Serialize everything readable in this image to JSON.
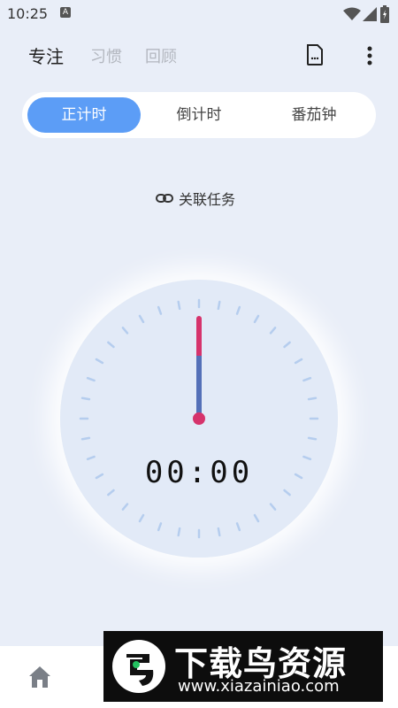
{
  "status_bar": {
    "time": "10:25",
    "notification_glyph": "A"
  },
  "header": {
    "tabs": [
      {
        "label": "专注",
        "active": true
      },
      {
        "label": "习惯",
        "active": false
      },
      {
        "label": "回顾",
        "active": false
      }
    ],
    "doc_icon": "document-icon",
    "more_icon": "more-vertical-icon"
  },
  "mode_selector": {
    "items": [
      {
        "label": "正计时",
        "selected": true
      },
      {
        "label": "倒计时",
        "selected": false
      },
      {
        "label": "番茄钟",
        "selected": false
      }
    ],
    "accent_color": "#5c9df6"
  },
  "link_task": {
    "icon": "link-icon",
    "label": "关联任务"
  },
  "timer": {
    "display": "00:00",
    "hand_colors": {
      "top": "#d6336c",
      "bottom": "#5470b8"
    }
  },
  "bottom_nav": {
    "home_icon": "home-icon"
  },
  "watermark": {
    "title": "下载鸟资源",
    "url": "www.xiazainiao.com"
  }
}
